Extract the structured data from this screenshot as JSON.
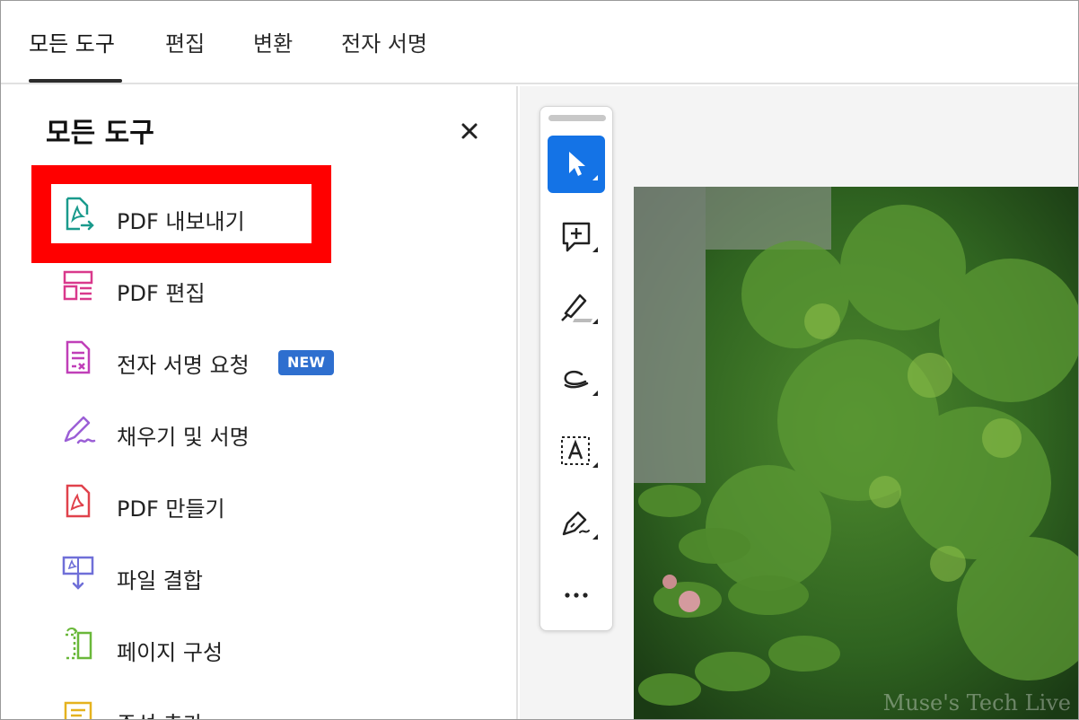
{
  "tabs": [
    {
      "label": "모든 도구",
      "active": true
    },
    {
      "label": "편집",
      "active": false
    },
    {
      "label": "변환",
      "active": false
    },
    {
      "label": "전자 서명",
      "active": false
    }
  ],
  "panel": {
    "title": "모든 도구",
    "close_icon": "close-icon",
    "items": [
      {
        "label": "PDF 내보내기",
        "icon": "export-pdf-icon",
        "color": "#1a9a8c"
      },
      {
        "label": "PDF 편집",
        "icon": "edit-pdf-icon",
        "color": "#d9398c"
      },
      {
        "label": "전자 서명 요청",
        "icon": "request-signature-icon",
        "color": "#c03fb8",
        "badge": "NEW"
      },
      {
        "label": "채우기 및 서명",
        "icon": "fill-sign-icon",
        "color": "#9b5fd6"
      },
      {
        "label": "PDF 만들기",
        "icon": "create-pdf-icon",
        "color": "#e0424c"
      },
      {
        "label": "파일 결합",
        "icon": "combine-files-icon",
        "color": "#6f6fd8"
      },
      {
        "label": "페이지 구성",
        "icon": "organize-pages-icon",
        "color": "#6ab83a"
      },
      {
        "label": "주석 추가",
        "icon": "add-comment-icon",
        "color": "#e5b21e"
      }
    ]
  },
  "toolbar": {
    "buttons": [
      {
        "icon": "select-cursor-icon",
        "active": true
      },
      {
        "icon": "add-comment-icon",
        "active": false
      },
      {
        "icon": "highlight-icon",
        "active": false
      },
      {
        "icon": "draw-freeform-icon",
        "active": false
      },
      {
        "icon": "add-text-icon",
        "active": false
      },
      {
        "icon": "sign-pen-icon",
        "active": false
      },
      {
        "icon": "more-icon",
        "active": false
      }
    ]
  },
  "document": {
    "watermark": "Muse's Tech Live"
  },
  "colors": {
    "accent": "#1473e6",
    "badge": "#2e6fcf",
    "annotation_box": "#ff0000"
  }
}
